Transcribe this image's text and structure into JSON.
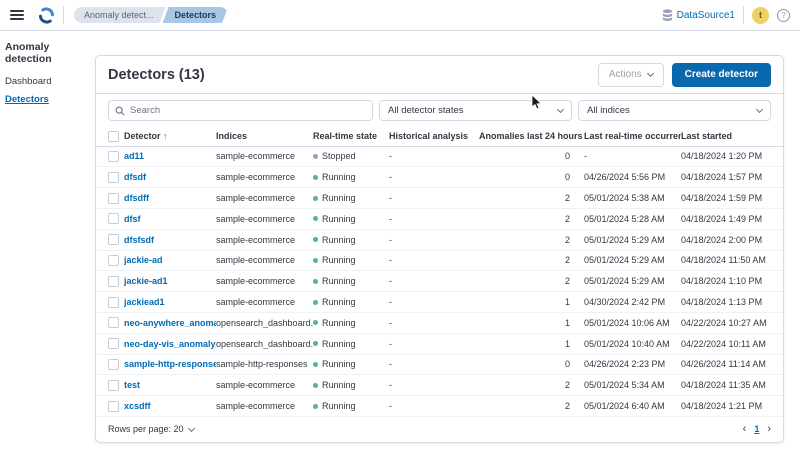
{
  "header": {
    "breadcrumbs": [
      {
        "label": "Anomaly detect..."
      },
      {
        "label": "Detectors"
      }
    ],
    "datasource_label": "DataSource1",
    "avatar_letter": "t",
    "help_glyph": "?"
  },
  "sidebar": {
    "title": "Anomaly detection",
    "items": [
      {
        "label": "Dashboard"
      },
      {
        "label": "Detectors"
      }
    ]
  },
  "main": {
    "title": "Detectors (13)",
    "actions_button": "Actions",
    "create_button": "Create detector",
    "search_placeholder": "Search",
    "filters": [
      "All detector states",
      "All indices"
    ],
    "table": {
      "columns": [
        "Detector",
        "Indices",
        "Real-time state",
        "Historical analysis",
        "Anomalies last 24 hours",
        "Last real-time occurrence",
        "Last started"
      ],
      "sort_icon": "↑",
      "rows": [
        {
          "detector": "ad11",
          "indices": "sample-ecommerce",
          "state": "Stopped",
          "historical": "-",
          "anomalies": "0",
          "last_occurrence": "-",
          "last_started": "04/18/2024 1:20 PM"
        },
        {
          "detector": "dfsdf",
          "indices": "sample-ecommerce",
          "state": "Running",
          "historical": "-",
          "anomalies": "0",
          "last_occurrence": "04/26/2024 5:56 PM",
          "last_started": "04/18/2024 1:57 PM"
        },
        {
          "detector": "dfsdff",
          "indices": "sample-ecommerce",
          "state": "Running",
          "historical": "-",
          "anomalies": "2",
          "last_occurrence": "05/01/2024 5:38 AM",
          "last_started": "04/18/2024 1:59 PM"
        },
        {
          "detector": "dfsf",
          "indices": "sample-ecommerce",
          "state": "Running",
          "historical": "-",
          "anomalies": "2",
          "last_occurrence": "05/01/2024 5:28 AM",
          "last_started": "04/18/2024 1:49 PM"
        },
        {
          "detector": "dfsfsdf",
          "indices": "sample-ecommerce",
          "state": "Running",
          "historical": "-",
          "anomalies": "2",
          "last_occurrence": "05/01/2024 5:29 AM",
          "last_started": "04/18/2024 2:00 PM"
        },
        {
          "detector": "jackie-ad",
          "indices": "sample-ecommerce",
          "state": "Running",
          "historical": "-",
          "anomalies": "2",
          "last_occurrence": "05/01/2024 5:29 AM",
          "last_started": "04/18/2024 11:50 AM"
        },
        {
          "detector": "jackie-ad1",
          "indices": "sample-ecommerce",
          "state": "Running",
          "historical": "-",
          "anomalies": "2",
          "last_occurrence": "05/01/2024 5:29 AM",
          "last_started": "04/18/2024 1:10 PM"
        },
        {
          "detector": "jackiead1",
          "indices": "sample-ecommerce",
          "state": "Running",
          "historical": "-",
          "anomalies": "1",
          "last_occurrence": "04/30/2024 2:42 PM",
          "last_started": "04/18/2024 1:13 PM"
        },
        {
          "detector": "neo-anywhere_anomal...",
          "indices": "opensearch_dashboard...",
          "state": "Running",
          "historical": "-",
          "anomalies": "1",
          "last_occurrence": "05/01/2024 10:06 AM",
          "last_started": "04/22/2024 10:27 AM"
        },
        {
          "detector": "neo-day-vis_anomaly_...",
          "indices": "opensearch_dashboard...",
          "state": "Running",
          "historical": "-",
          "anomalies": "1",
          "last_occurrence": "05/01/2024 10:40 AM",
          "last_started": "04/22/2024 10:11 AM"
        },
        {
          "detector": "sample-http-response...",
          "indices": "sample-http-responses",
          "state": "Running",
          "historical": "-",
          "anomalies": "0",
          "last_occurrence": "04/26/2024 2:23 PM",
          "last_started": "04/26/2024 11:14 AM"
        },
        {
          "detector": "test",
          "indices": "sample-ecommerce",
          "state": "Running",
          "historical": "-",
          "anomalies": "2",
          "last_occurrence": "05/01/2024 5:34 AM",
          "last_started": "04/18/2024 11:35 AM"
        },
        {
          "detector": "xcsdff",
          "indices": "sample-ecommerce",
          "state": "Running",
          "historical": "-",
          "anomalies": "2",
          "last_occurrence": "05/01/2024 6:40 AM",
          "last_started": "04/18/2024 1:21 PM"
        }
      ]
    },
    "footer": {
      "rows_per_page": "Rows per page: 20",
      "page": "1",
      "prev": "‹",
      "next": "›"
    }
  },
  "icons": {
    "menu-icon": "hamburger-lines",
    "opensearch-logo": "blue-swirl",
    "database-icon": "cylinder",
    "search-icon": "magnifier",
    "chevron-down-icon": "v",
    "help-icon": "circled-question-mark",
    "sort-asc-icon": "↑"
  },
  "colors": {
    "accent": "#006bb4",
    "primary_button": "#0a68af",
    "running_dot": "#54b399",
    "stopped_dot": "#98a2b3",
    "avatar_bg": "#f0cf65",
    "border": "#d3dae6",
    "breadcrumb_bg": "#dce3ee",
    "breadcrumb_active_bg": "#a7c7e4",
    "text": "#343741",
    "muted": "#69707d"
  }
}
